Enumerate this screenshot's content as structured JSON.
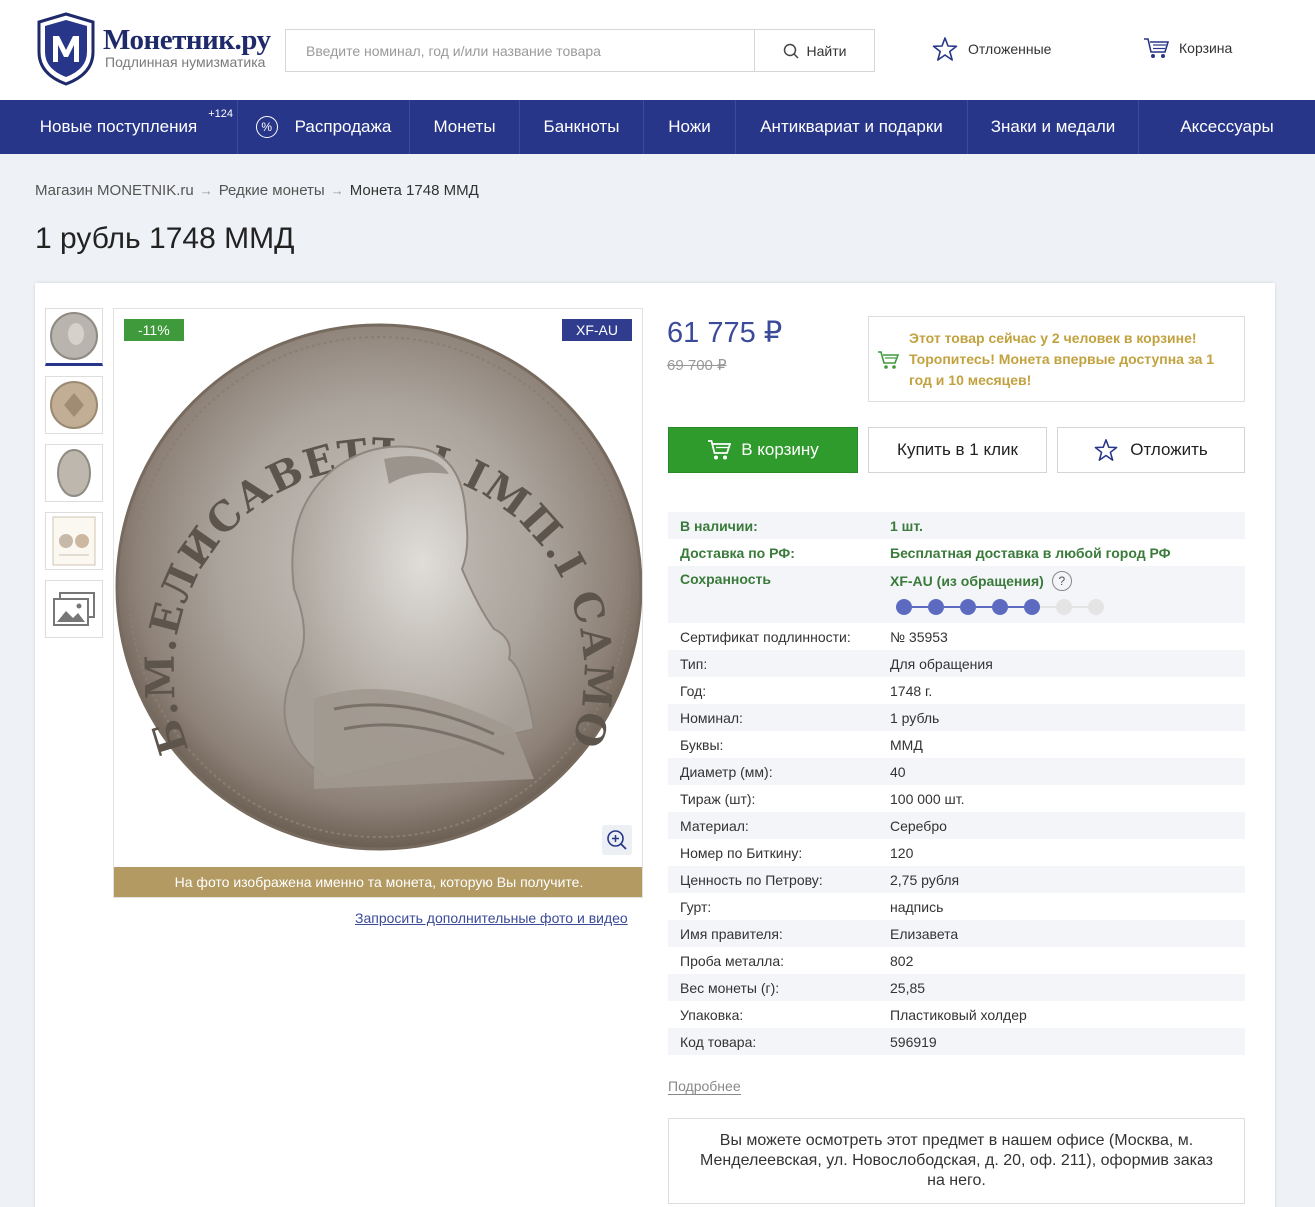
{
  "brand": {
    "name": "Монетник.ру",
    "tagline": "Подлинная нумизматика"
  },
  "search": {
    "placeholder": "Введите номинал, год и/или название товара",
    "button_label": "Найти"
  },
  "header_links": {
    "deferred": "Отложенные",
    "cart": "Корзина"
  },
  "nav": {
    "new_arrivals": "Новые поступления",
    "new_arrivals_badge": "+124",
    "sale_icon": "%",
    "sale": "Распродажа",
    "coins": "Монеты",
    "banknotes": "Банкноты",
    "knives": "Ножи",
    "antiques": "Антиквариат и подарки",
    "medals": "Знаки и медали",
    "accessories": "Аксессуары"
  },
  "breadcrumb": {
    "home": "Магазин MONETNIK.ru",
    "category": "Редкие монеты",
    "current": "Монета 1748 ММД",
    "separator": "→"
  },
  "product": {
    "title": "1 рубль 1748 ММД",
    "discount_badge": "-11%",
    "grade_badge": "XF-AU",
    "photo_caption": "На фото изображена именно та монета, которую Вы получите.",
    "request_media_link": "Запросить дополнительные фото и видео",
    "price": "61 775 ₽",
    "old_price": "69 700 ₽",
    "promo": "Этот товар сейчас у 2 человек в корзине! Торопитесь! Монета впервые доступна за 1 год и 10 месяцев!",
    "add_to_cart": "В корзину",
    "buy_one_click": "Купить в 1 клик",
    "defer": "Отложить",
    "more_link": "Подробнее",
    "office_note": "Вы можете осмотреть этот предмет в нашем офисе (Москва, м. Менделеевская, ул. Новослободская, д. 20, оф. 211), оформив заказ на него.",
    "grade_scale": {
      "filled": 5,
      "total": 7
    }
  },
  "coin_legend": "Б.М.ЕЛИСАВЕТЪ I IМП.I САМОД.ВСЕРОС.",
  "specs": {
    "availability": {
      "k": "В наличии:",
      "v": "1 шт."
    },
    "delivery": {
      "k": "Доставка по РФ:",
      "v": "Бесплатная доставка в любой город РФ"
    },
    "condition": {
      "k": "Сохранность",
      "v": "XF-AU (из обращения)",
      "help": "?"
    },
    "rows": [
      {
        "k": "Сертификат подлинности:",
        "v": "№ 35953"
      },
      {
        "k": "Тип:",
        "v": "Для обращения"
      },
      {
        "k": "Год:",
        "v": "1748 г."
      },
      {
        "k": "Номинал:",
        "v": "1 рубль"
      },
      {
        "k": "Буквы:",
        "v": "ММД"
      },
      {
        "k": "Диаметр (мм):",
        "v": "40"
      },
      {
        "k": "Тираж (шт):",
        "v": "100 000 шт."
      },
      {
        "k": "Материал:",
        "v": "Серебро"
      },
      {
        "k": "Номер по Биткину:",
        "v": "120"
      },
      {
        "k": "Ценность по Петрову:",
        "v": "2,75 рубля"
      },
      {
        "k": "Гурт:",
        "v": "надпись"
      },
      {
        "k": "Имя правителя:",
        "v": "Елизавета"
      },
      {
        "k": "Проба металла:",
        "v": "802"
      },
      {
        "k": "Вес монеты (г):",
        "v": "25,85"
      },
      {
        "k": "Упаковка:",
        "v": "Пластиковый холдер"
      },
      {
        "k": "Код товара:",
        "v": "596919"
      }
    ]
  },
  "colors": {
    "nav_bg": "#283689",
    "accent_blue": "#3b4a99",
    "buy_green": "#2f9b2c",
    "promo_gold": "#c2a23f",
    "caption_bg": "#b29a62"
  }
}
